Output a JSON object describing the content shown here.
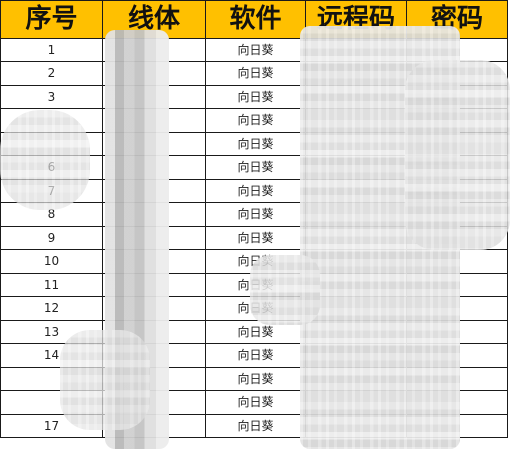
{
  "table": {
    "headers": [
      "序号",
      "线体",
      "软件",
      "远程码",
      "密码"
    ],
    "rows": [
      {
        "seq": "1",
        "software": "向日葵"
      },
      {
        "seq": "2",
        "software": "向日葵"
      },
      {
        "seq": "3",
        "software": "向日葵"
      },
      {
        "seq": "",
        "software": "向日葵"
      },
      {
        "seq": "",
        "software": "向日葵"
      },
      {
        "seq": "6",
        "software": "向日葵"
      },
      {
        "seq": "7",
        "software": "向日葵"
      },
      {
        "seq": "8",
        "software": "向日葵"
      },
      {
        "seq": "9",
        "software": "向日葵"
      },
      {
        "seq": "10",
        "software": "向日葵"
      },
      {
        "seq": "11",
        "software": "向日葵"
      },
      {
        "seq": "12",
        "software": "向日葵"
      },
      {
        "seq": "13",
        "software": "向日葵"
      },
      {
        "seq": "14",
        "software": "向日葵"
      },
      {
        "seq": "",
        "software": "向日葵"
      },
      {
        "seq": "",
        "software": "向日葵"
      },
      {
        "seq": "17",
        "software": "向日葵"
      }
    ]
  },
  "colors": {
    "header_background": "#ffc000",
    "grid_line": "#1a1a1a",
    "redaction": "#d9d9d9"
  }
}
